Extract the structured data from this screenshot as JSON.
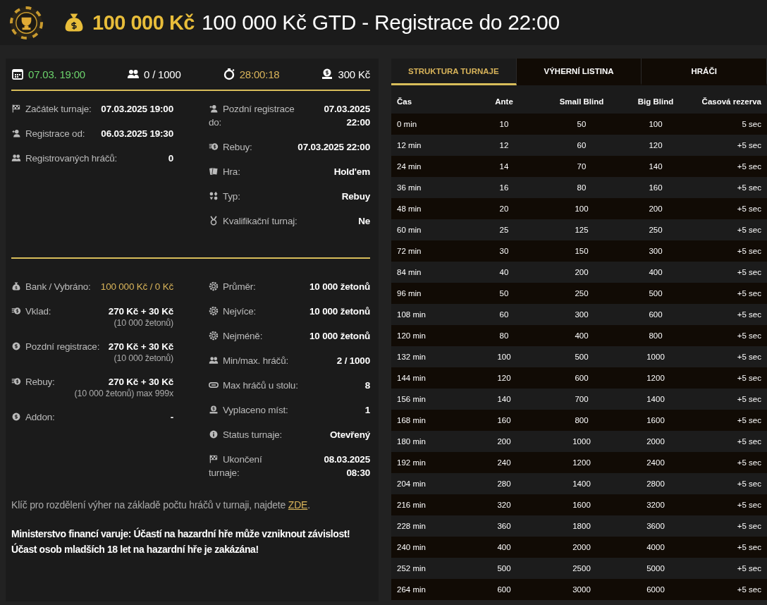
{
  "header": {
    "prize": "100 000 Kč",
    "title": "100 000 Kč GTD - Registrace do 22:00"
  },
  "stats": [
    {
      "kind": "date",
      "text": "07.03. 19:00"
    },
    {
      "kind": "players",
      "text": "0 / 1000"
    },
    {
      "kind": "countdown",
      "text": "28:00:18"
    },
    {
      "kind": "buyin",
      "text": "300 Kč"
    }
  ],
  "info_left": [
    {
      "kind": "flag",
      "label": "Začátek turnaje:",
      "value": "07.03.2025 19:00"
    },
    {
      "kind": "userplus",
      "label": "Registrace od:",
      "value": "06.03.2025 19:30"
    },
    {
      "kind": "users",
      "label": "Registrovaných hráčů:",
      "value": "0"
    }
  ],
  "info_right": [
    {
      "kind": "userplus",
      "label": "Pozdní registrace do:",
      "value": "07.03.2025 22:00"
    },
    {
      "kind": "coins",
      "label": "Rebuy:",
      "value": "07.03.2025 22:00"
    },
    {
      "kind": "cards",
      "label": "Hra:",
      "value": "Hold'em"
    },
    {
      "kind": "suits",
      "label": "Typ:",
      "value": "Rebuy"
    },
    {
      "kind": "medal",
      "label": "Kvalifikační turnaj:",
      "value": "Ne"
    }
  ],
  "money_left": [
    {
      "kind": "bag",
      "label": "Bank / Vybráno:",
      "value": "100 000 Kč / 0 Kč",
      "highlighted": true
    },
    {
      "kind": "coins",
      "label": "Vklad:",
      "value": "270 Kč + 30 Kč",
      "note": "(10 000 žetonů)",
      "highlighted": false
    },
    {
      "kind": "dollar",
      "label": "Pozdní registrace:",
      "value": "270 Kč + 30 Kč",
      "note": "(10 000 žetonů)",
      "highlighted": false
    },
    {
      "kind": "coins",
      "label": "Rebuy:",
      "value": "270 Kč + 30 Kč",
      "note": "(10 000 žetonů) max 999x",
      "highlighted": false
    },
    {
      "kind": "dollar",
      "label": "Addon:",
      "value": "-",
      "highlighted": false
    }
  ],
  "money_right": [
    {
      "kind": "chip",
      "label": "Průměr:",
      "value": "10 000 žetonů"
    },
    {
      "kind": "chip",
      "label": "Nejvíce:",
      "value": "10 000 žetonů"
    },
    {
      "kind": "chip",
      "label": "Nejméně:",
      "value": "10 000 žetonů"
    },
    {
      "kind": "users",
      "label": "Min/max. hráčů:",
      "value": "2 / 1000"
    },
    {
      "kind": "table",
      "label": "Max hráčů u stolu:",
      "value": "8"
    },
    {
      "kind": "payout",
      "label": "Vyplaceno míst:",
      "value": "1"
    },
    {
      "kind": "info",
      "label": "Status turnaje:",
      "value": "Otevřený"
    },
    {
      "kind": "flag",
      "label": "Ukončení turnaje:",
      "value": "08.03.2025 08:30"
    }
  ],
  "payout_note": {
    "text": "Klíč pro rozdělení výher na základě počtu hráčů v turnaji, najdete",
    "link": "ZDE",
    "end": "."
  },
  "warning": [
    "Ministerstvo financí varuje: Účastí na hazardní hře může vzniknout závislost!",
    "Účast osob mladších 18 let na hazardní hře je zakázána!"
  ],
  "tabs": [
    {
      "label": "STRUKTURA TURNAJE",
      "selected": true
    },
    {
      "label": "VÝHERNÍ LISTINA",
      "selected": false
    },
    {
      "label": "HRÁČI",
      "selected": false
    }
  ],
  "table": {
    "columns": [
      "Čas",
      "Ante",
      "Small Blind",
      "Big Blind",
      "Časová rezerva"
    ],
    "rows": [
      [
        "0 min",
        "10",
        "50",
        "100",
        "5 sec"
      ],
      [
        "12 min",
        "12",
        "60",
        "120",
        "+5 sec"
      ],
      [
        "24 min",
        "14",
        "70",
        "140",
        "+5 sec"
      ],
      [
        "36 min",
        "16",
        "80",
        "160",
        "+5 sec"
      ],
      [
        "48 min",
        "20",
        "100",
        "200",
        "+5 sec"
      ],
      [
        "60 min",
        "25",
        "125",
        "250",
        "+5 sec"
      ],
      [
        "72 min",
        "30",
        "150",
        "300",
        "+5 sec"
      ],
      [
        "84 min",
        "40",
        "200",
        "400",
        "+5 sec"
      ],
      [
        "96 min",
        "50",
        "250",
        "500",
        "+5 sec"
      ],
      [
        "108 min",
        "60",
        "300",
        "600",
        "+5 sec"
      ],
      [
        "120 min",
        "80",
        "400",
        "800",
        "+5 sec"
      ],
      [
        "132 min",
        "100",
        "500",
        "1000",
        "+5 sec"
      ],
      [
        "144 min",
        "120",
        "600",
        "1200",
        "+5 sec"
      ],
      [
        "156 min",
        "140",
        "700",
        "1400",
        "+5 sec"
      ],
      [
        "168 min",
        "160",
        "800",
        "1600",
        "+5 sec"
      ],
      [
        "180 min",
        "200",
        "1000",
        "2000",
        "+5 sec"
      ],
      [
        "192 min",
        "240",
        "1200",
        "2400",
        "+5 sec"
      ],
      [
        "204 min",
        "280",
        "1400",
        "2800",
        "+5 sec"
      ],
      [
        "216 min",
        "320",
        "1600",
        "3200",
        "+5 sec"
      ],
      [
        "228 min",
        "360",
        "1800",
        "3600",
        "+5 sec"
      ],
      [
        "240 min",
        "400",
        "2000",
        "4000",
        "+5 sec"
      ],
      [
        "252 min",
        "500",
        "2500",
        "5000",
        "+5 sec"
      ],
      [
        "264 min",
        "600",
        "3000",
        "6000",
        "+5 sec"
      ]
    ]
  }
}
